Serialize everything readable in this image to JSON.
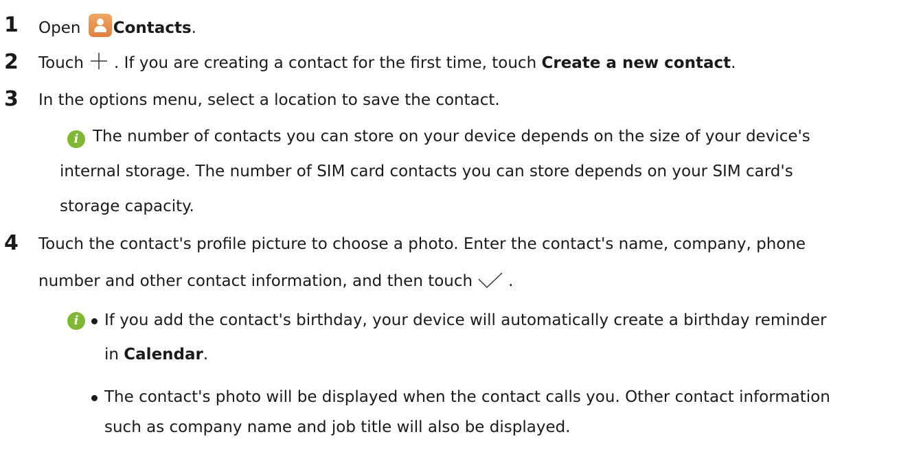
{
  "steps": [
    {
      "num": "1",
      "pre": "Open ",
      "bold": "Contacts",
      "post": "."
    },
    {
      "num": "2",
      "pre": "Touch",
      "mid": ". If you are creating a contact for the first time, touch ",
      "bold": "Create a new contact",
      "post": "."
    },
    {
      "num": "3",
      "text": "In the options menu, select a location to save the contact."
    },
    {
      "num": "4",
      "line1": "Touch the contact's profile picture to choose a photo. Enter the contact's name, company, phone",
      "line2_pre": "number and other contact information, and then touch",
      "line2_post": "."
    }
  ],
  "note1": {
    "line1": "The number of contacts you can store on your device depends on the size of your device's",
    "line2": "internal storage. The number of SIM card contacts you can store depends on your SIM card's",
    "line3": "storage capacity."
  },
  "note2": {
    "bullet1_line1": "If you add the contact's birthday, your device will automatically create a birthday reminder",
    "bullet1_line2_pre": "in ",
    "bullet1_line2_bold": "Calendar",
    "bullet1_line2_post": ".",
    "bullet2_line1": "The contact's photo will be displayed when the contact calls you. Other contact information",
    "bullet2_line2": "such as company name and job title will also be displayed."
  },
  "icons": {
    "app": "contacts-app-icon",
    "add": "plus-icon",
    "confirm": "checkmark-icon",
    "info": "info-icon",
    "info_color": "#7fb832",
    "app_color": "#e8904a"
  }
}
